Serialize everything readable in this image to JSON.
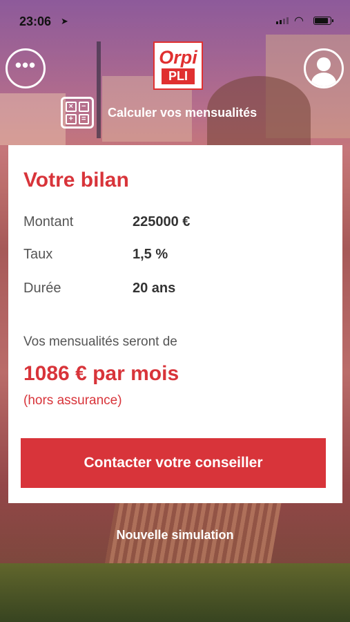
{
  "status_bar": {
    "time": "23:06"
  },
  "header": {
    "menu_glyph": "•••",
    "logo": {
      "brand": "Orpi",
      "sub": "PLI"
    },
    "calculator_label": "Calculer vos mensualités",
    "calculator_keys": [
      "×",
      "−",
      "+",
      "="
    ]
  },
  "summary": {
    "title": "Votre bilan",
    "rows": [
      {
        "label": "Montant",
        "value": "225000 €"
      },
      {
        "label": "Taux",
        "value": "1,5 %"
      },
      {
        "label": "Durée",
        "value": "20 ans"
      }
    ],
    "intro": "Vos mensualités seront de",
    "amount": "1086 € par mois",
    "note": "(hors assurance)",
    "cta_label": "Contacter votre conseiller"
  },
  "footer": {
    "new_simulation": "Nouvelle simulation"
  },
  "colors": {
    "accent": "#d8343a",
    "card": "#ffffff"
  },
  "icons": [
    "location-arrow-icon",
    "signal-icon",
    "wifi-icon",
    "battery-icon",
    "menu-dots-icon",
    "profile-icon",
    "calculator-icon"
  ]
}
